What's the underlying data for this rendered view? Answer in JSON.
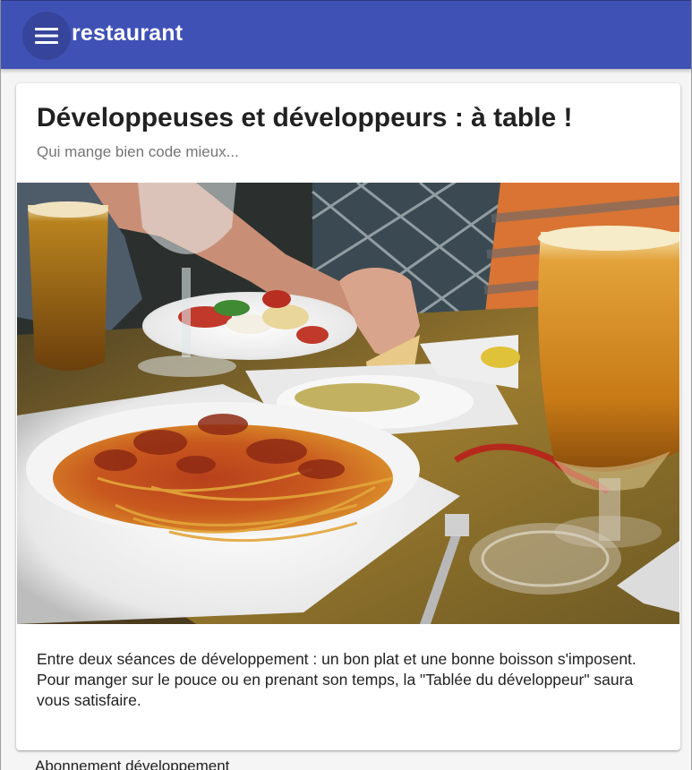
{
  "app_bar": {
    "title": "restaurant",
    "menu_icon": "hamburger-menu-icon",
    "color": "#3f51b5"
  },
  "card": {
    "title": "Développeuses et développeurs : à table !",
    "subtitle": "Qui mange bien code mieux...",
    "paragraphs": [
      "Entre deux séances de développement : un bon plat et une bonne boisson s'imposent.",
      "Pour manger sur le pouce ou en prenant son temps, la \"Tablée du développeur\" saura vous satisfaire."
    ]
  },
  "below_card": {
    "text": "Abonnement développement"
  }
}
